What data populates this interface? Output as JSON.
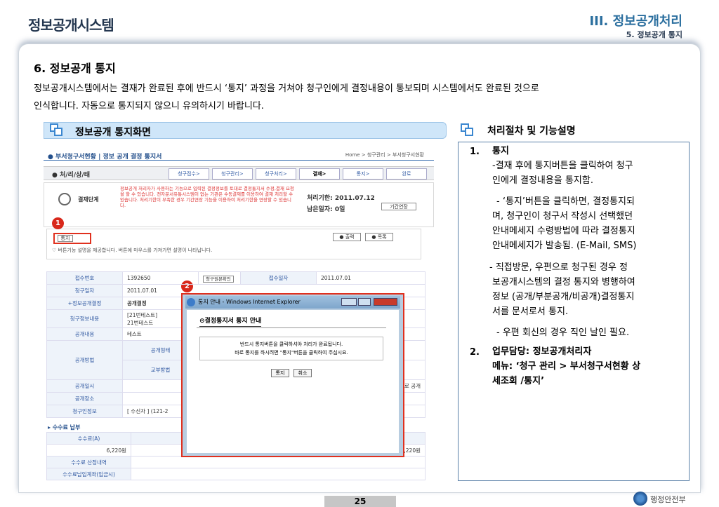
{
  "header": {
    "title": "정보공개시스템",
    "chapter": "III. 정보공개처리",
    "subchapter": "5. 정보공개 통지"
  },
  "section": {
    "title": "6. 정보공개 통지",
    "intro_lines": [
      "정보공개시스템에서는 결재가 완료된 후에 반드시 ‘통지’ 과정을 거쳐야 청구인에게 결정내용이 통보되며 시스템에서도  완료된 것으로",
      "인식합니다. 자동으로 통지되지 않으니 유의하시기 바랍니다."
    ]
  },
  "left_panel": {
    "title": "정보공개 통지화면"
  },
  "right_panel": {
    "title": "처리절차 및 기능설명",
    "items": [
      {
        "num": "1.",
        "head": "통지",
        "lines": [
          "-결재 후에 통지버튼을 클릭하여 청구",
          "인에게 결정내용을 통지함.",
          "",
          "- ‘통지’버튼을 클릭하면, 결정통지되",
          "며, 청구인이 청구서 작성시 선택했던",
          "안내메세지 수령방법에 따라 결정통지",
          "안내메세지가 발송됨. (E-Mail, SMS)"
        ]
      },
      {
        "lines": [
          "- 직접방문, 우편으로 청구된 경우 정",
          "보공개시스템의 결정 통지와 병행하여",
          "정보 (공개/부분공개/비공개)결정통지",
          "서를 문서로서 통지.",
          "",
          "- 우편 회신의 경우 직인 날인 필요."
        ]
      },
      {
        "num": "2.",
        "head": "업무담당: 정보공개처리자",
        "lines": [
          "메뉴: ‘청구 관리 > 부서청구서현황 상",
          "세조회 /통지’"
        ]
      }
    ]
  },
  "screenshot": {
    "crumb": "● 부서청구서현황 | 정보 공개 결정 통지서",
    "crumb_right": "Home > 청구관리 > 부서청구서현황",
    "status_label": "● 처/리/상/태",
    "tabs": [
      "청구접수>",
      "청구관리>",
      "청구처리>",
      "결재>",
      "통지>",
      "완료"
    ],
    "step_label": "결재단계",
    "step_text": "정보공개 처리자가 사용하는 기능으로 입력된 결정정보를 토대로 결정통지서 수정,결재 요청을 할 수 있습니다. 전자문서유통시스템이 없는 기관은 수동결재를 이용하여 결재 처리할 수 있습니다. 처리기한이 부족한 경우 기간연장 기능을 이용하여 처리기한을 연장할 수 있습니다.",
    "deadline": "처리기한: 2011.07.12",
    "remaining": "남은일자: 0일",
    "extend": "기간연장",
    "notify_btn": "통지",
    "print_btn": "● 출력",
    "list_btn": "● 목록",
    "hint": "♡ 버튼기능 설명을 제공합니다. 버튼에 마우스를 가져가면 설명이 나타납니다.",
    "rows": [
      [
        "접수번호",
        "1392650",
        "청구원본확인",
        "접수일자",
        "2011.07.01"
      ],
      [
        "청구일자",
        "2011.07.01",
        "",
        "",
        ""
      ],
      [
        "+정보공개결정",
        "공개결정",
        "",
        "",
        ""
      ],
      [
        "청구정보내용",
        "[21번테스트]\n21번테스트",
        "",
        "",
        ""
      ],
      [
        "공개내용",
        "테스트",
        "",
        "",
        ""
      ],
      [
        "공개방법",
        "공개형태",
        "",
        "",
        ""
      ],
      [
        "",
        "교부방법",
        "",
        "",
        ""
      ],
      [
        "공개일시",
        "",
        "",
        "",
        "로 공개"
      ],
      [
        "공개장소",
        "",
        "",
        "",
        ""
      ],
      [
        "청구인정보",
        "[ 수신자 ] (121-2",
        "",
        "",
        ""
      ]
    ],
    "fee_title": "▸ 수수료 납부",
    "fee_rows": [
      [
        "수수료(A)",
        "우"
      ],
      [
        "6,220원",
        "",
        ",220원"
      ],
      [
        "수수료 산정내역",
        ""
      ],
      [
        "수수료납입계좌(입금시)",
        ""
      ]
    ],
    "badge1": "1",
    "badge2": "2",
    "popup": {
      "title": "통지 안내 - Windows Internet Explorer",
      "heading": "⊙결정통지서 통지 안내",
      "msg1": "반드시 통지버튼을 클릭하셔야 처리가 완료됩니다.",
      "msg2": "바로 통지를 하시려면 \"통지\"버튼을 클릭하여 주십시요.",
      "ok": "통지",
      "cancel": "취소"
    }
  },
  "footer": {
    "page": "25",
    "logo": "행정안전부"
  }
}
